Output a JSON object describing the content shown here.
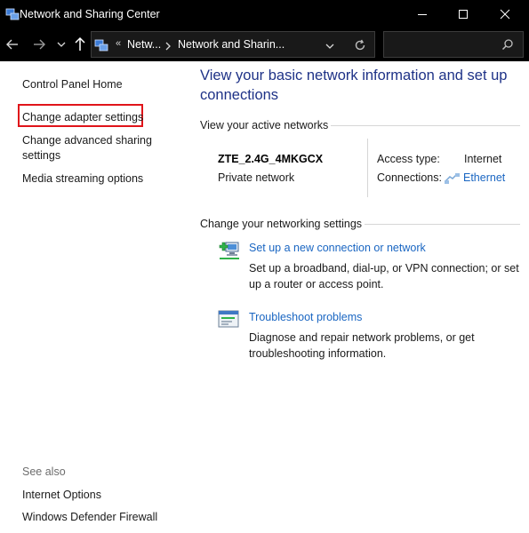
{
  "window": {
    "title": "Network and Sharing Center"
  },
  "address": {
    "overflow": "«",
    "crumb1": "Netw...",
    "crumb2": "Network and Sharin...",
    "search_placeholder": ""
  },
  "sidebar": {
    "items": [
      {
        "label": "Control Panel Home"
      },
      {
        "label": "Change adapter settings"
      },
      {
        "label": "Change advanced sharing\nsettings"
      },
      {
        "label": "Media streaming options"
      }
    ],
    "see_also": "See also",
    "see_also_items": [
      {
        "label": "Internet Options"
      },
      {
        "label": "Windows Defender Firewall"
      }
    ]
  },
  "main": {
    "title": "View your basic network information and set up connections",
    "active_networks_heading": "View your active networks",
    "network": {
      "name": "ZTE_2.4G_4MKGCX",
      "type": "Private network",
      "access_type_label": "Access type:",
      "access_type_value": "Internet",
      "connections_label": "Connections:",
      "connections_value": "Ethernet"
    },
    "settings_heading": "Change your networking settings",
    "tasks": [
      {
        "link": "Set up a new connection or network",
        "desc": "Set up a broadband, dial-up, or VPN connection; or set up a router or access point.",
        "icon": "network-setup-icon"
      },
      {
        "link": "Troubleshoot problems",
        "desc": "Diagnose and repair network problems, or get troubleshooting information.",
        "icon": "troubleshoot-icon"
      }
    ]
  },
  "colors": {
    "titlebar_bg": "#000000",
    "heading_blue": "#1e3287",
    "link_blue": "#1a66c2",
    "highlight_red": "#e0141a"
  }
}
